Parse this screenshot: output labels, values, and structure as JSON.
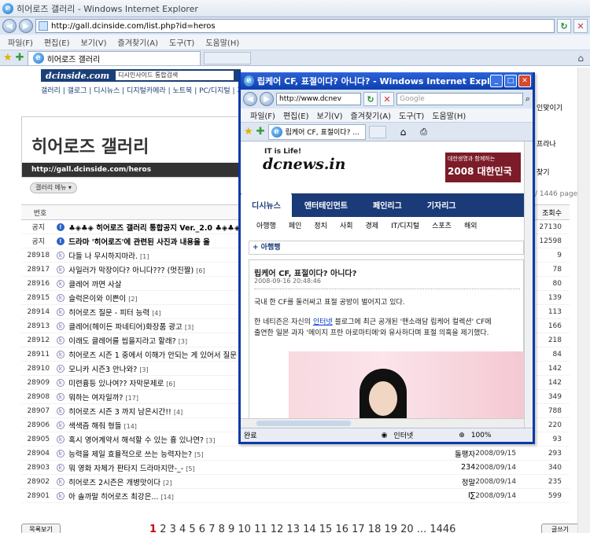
{
  "bg": {
    "title": "히어로즈 갤러리 - Windows Internet Explorer",
    "url": "http://gall.dcinside.com/list.php?id=heros",
    "menu": [
      "파일(F)",
      "편집(E)",
      "보기(V)",
      "즐겨찾기(A)",
      "도구(T)",
      "도움말(H)"
    ],
    "tab_label": "히어로즈 갤러리",
    "site": {
      "logo": "dcinside.com",
      "search_placeholder": "디시인사이드 통합검색",
      "menu_links": "갤러리 | 갤로그 | 디시뉴스 | 디지털카메라 | 노트북 | PC/디지털 | 자동",
      "gallery_title": "히어로즈 갤러리",
      "gallery_url": "http://gall.dcinside.com/heros",
      "gallery_menu": "갤러리 메뉴 ▾",
      "right_bits": [
        "인맞이기",
        "프라나",
        "찾기",
        "/ 1446 pages"
      ]
    },
    "table": {
      "header_no": "번호",
      "header_views": "조회수",
      "rows": [
        {
          "no": "공지",
          "icon": "i",
          "title": "♣◈♣◈ 히어로즈 갤러리 통합공지 Ver._2.0 ♣◈♣◈",
          "cnt": "",
          "author": "",
          "date": "",
          "views": "27130"
        },
        {
          "no": "공지",
          "icon": "i",
          "title": "드라마 '히어로즈'에 관련된 사진과 내용을 올",
          "cnt": "",
          "author": "",
          "date": "",
          "views": "12598"
        },
        {
          "no": "28918",
          "icon": "c",
          "title": "다들 나 무시하지마라.",
          "cnt": "[1]",
          "author": "",
          "date": "",
          "views": "9"
        },
        {
          "no": "28917",
          "icon": "c",
          "title": "사일러가 막장이다? 아니다??? (멋진짤)",
          "cnt": "[6]",
          "author": "",
          "date": "",
          "views": "78"
        },
        {
          "no": "28916",
          "icon": "c",
          "title": "클레어 까면 사살",
          "cnt": "",
          "author": "",
          "date": "",
          "views": "80"
        },
        {
          "no": "28915",
          "icon": "c",
          "title": "슬럭은이와 이쁜이",
          "cnt": "[2]",
          "author": "",
          "date": "",
          "views": "139"
        },
        {
          "no": "28914",
          "icon": "c",
          "title": "히어로즈 질문 - 피터 능력",
          "cnt": "[4]",
          "author": "",
          "date": "",
          "views": "113"
        },
        {
          "no": "28913",
          "icon": "c",
          "title": "클레어(헤이든 파네티어)화장품 광고",
          "cnt": "[3]",
          "author": "",
          "date": "",
          "views": "166"
        },
        {
          "no": "28912",
          "icon": "c",
          "title": "이래도 클레어를 씹을지라고 할래?",
          "cnt": "[3]",
          "author": "",
          "date": "",
          "views": "218"
        },
        {
          "no": "28911",
          "icon": "c",
          "title": "히어로즈 시즌 1 중에서 이해가 안되는 게 있어서 질문",
          "cnt": "",
          "author": "",
          "date": "",
          "views": "84"
        },
        {
          "no": "28910",
          "icon": "c",
          "title": "모니카 시즌3 안나와?",
          "cnt": "[3]",
          "author": "",
          "date": "",
          "views": "142"
        },
        {
          "no": "28909",
          "icon": "c",
          "title": "미련흉등 있나여?? 자막문제로",
          "cnt": "[6]",
          "author": "",
          "date": "",
          "views": "142"
        },
        {
          "no": "28908",
          "icon": "c",
          "title": "뭐하는 여자일까?",
          "cnt": "[17]",
          "author": "",
          "date": "",
          "views": "349"
        },
        {
          "no": "28907",
          "icon": "c",
          "title": "히어로즈 시즌 3 까지 남은시간!!",
          "cnt": "[4]",
          "author": "",
          "date": "",
          "views": "788"
        },
        {
          "no": "28906",
          "icon": "c",
          "title": "색색즘 해줘 형들",
          "cnt": "[14]",
          "author": "",
          "date": "",
          "views": "220"
        },
        {
          "no": "28905",
          "icon": "c",
          "title": "혹시 영어계약서 해석할 수 있는 흉 있나연?",
          "cnt": "[3]",
          "author": "",
          "date": "",
          "views": "93"
        },
        {
          "no": "28904",
          "icon": "c",
          "title": "능력을 제일 효율적으로 쓰는 능력자는?",
          "cnt": "[5]",
          "author": "돌팽자",
          "date": "2008/09/15",
          "views": "293"
        },
        {
          "no": "28903",
          "icon": "c",
          "title": "뭐 영화 자체가 판타지 드라마지만-_-",
          "cnt": "[5]",
          "author": "234",
          "date": "2008/09/14",
          "views": "340"
        },
        {
          "no": "28902",
          "icon": "c",
          "title": "히어로즈 2시즌은 개병맛이다",
          "cnt": "[2]",
          "author": "정말",
          "date": "2008/09/14",
          "views": "235"
        },
        {
          "no": "28901",
          "icon": "c",
          "title": "아 솔까말 히어로즈 최강은...",
          "cnt": "[14]",
          "author": "I∑",
          "date": "2008/09/14",
          "views": "599"
        }
      ]
    },
    "list_button": "목록보기",
    "write_button": "글쓰기",
    "pager_current": "1",
    "pager": "2 3 4 5 6 7 8 9 10 11 12 13 14 15 16 17 18 19 20 ... 1446"
  },
  "popup": {
    "title": "립케어 CF, 표절이다? 아니다? - Windows Internet Explorer",
    "url": "http://www.dcnev",
    "search_placeholder": "Google",
    "menu": [
      "파일(F)",
      "편집(E)",
      "보기(V)",
      "즐겨찾기(A)",
      "도구(T)",
      "도움말(H)"
    ],
    "tab_label": "립케어 CF, 표절이다? ...",
    "site": {
      "tagline": "IT is Life!",
      "logo": "dcnews.in",
      "ad_small": "대한생명과 함께하는",
      "ad_big": "2008 대한민국",
      "nav": [
        "디시뉴스",
        "엔터테인먼트",
        "페인리그",
        "기자리그"
      ],
      "subnav": [
        "아행행",
        "페인",
        "정치",
        "사회",
        "경제",
        "IT/디지털",
        "스포츠",
        "해외"
      ],
      "section": "+ 아햄행",
      "article_title": "립케어 CF, 표절이다? 아니다?",
      "article_date": "2008-09-16 20:48:46",
      "para1": "국내 한 CF를 둘러싸고 표절 공방이 벌어지고 있다.",
      "para2a": "한 네티즌은 자신의 ",
      "para2link": "인터넷",
      "para2b": " 블로그에 최근 공개된 '맨소래담 립케어 컬렉션' CF에",
      "para3": "출연한 일본 과자 '메이지 프란 아로마티에'와 유사하다며 표절 의혹을 제기했다."
    },
    "status_left": "완료",
    "status_zone": "인터넷",
    "status_zoom": "100%"
  }
}
